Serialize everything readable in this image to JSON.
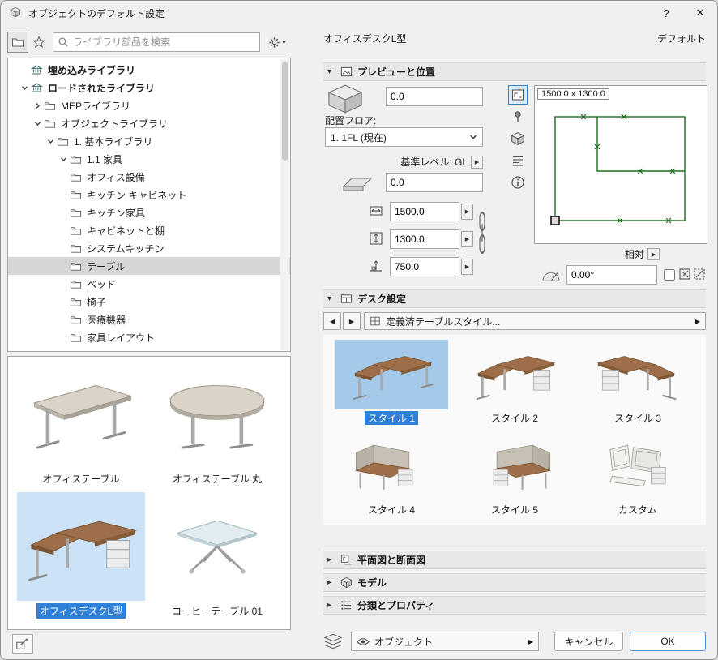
{
  "window": {
    "title": "オブジェクトのデフォルト設定",
    "help": "?",
    "close": "✕"
  },
  "glyphs": {
    "expand": "▾",
    "collapse": "▸",
    "prev": "◀",
    "next": "▶",
    "spinner": "▶",
    "dropdown": "▾"
  },
  "search": {
    "placeholder": "ライブラリ部品を検索"
  },
  "tree": [
    {
      "label": "埋め込みライブラリ"
    },
    {
      "label": "ロードされたライブラリ"
    },
    {
      "label": "MEPライブラリ"
    },
    {
      "label": "オブジェクトライブラリ"
    },
    {
      "label": "1. 基本ライブラリ"
    },
    {
      "label": "1.1 家具"
    },
    {
      "label": "オフィス設備"
    },
    {
      "label": "キッチン キャビネット"
    },
    {
      "label": "キッチン家具"
    },
    {
      "label": "キャビネットと棚"
    },
    {
      "label": "システムキッチン"
    },
    {
      "label": "テーブル"
    },
    {
      "label": "ベッド"
    },
    {
      "label": "椅子"
    },
    {
      "label": "医療機器"
    },
    {
      "label": "家具レイアウト"
    }
  ],
  "thumbs": [
    {
      "label": "オフィステーブル",
      "selected": false
    },
    {
      "label": "オフィステーブル 丸",
      "selected": false
    },
    {
      "label": "オフィスデスクL型",
      "selected": true
    },
    {
      "label": "コーヒーテーブル 01",
      "selected": false
    }
  ],
  "obj": {
    "name": "オフィスデスクL型",
    "state": "デフォルト"
  },
  "prev": {
    "title": "プレビューと位置",
    "z1": "0.0",
    "floor_label": "配置フロア:",
    "floor_value": "1. 1FL (現在)",
    "base_level": "基準レベル: GL",
    "z2": "0.0",
    "w": "1500.0",
    "d": "1300.0",
    "h": "750.0",
    "dims": "1500.0 x 1300.0",
    "relative": "相対",
    "angle": "0.00°"
  },
  "desk": {
    "title": "デスク設定",
    "header": "定義済テーブルスタイル...",
    "styles": [
      {
        "label": "スタイル 1",
        "selected": true
      },
      {
        "label": "スタイル 2",
        "selected": false
      },
      {
        "label": "スタイル 3",
        "selected": false
      },
      {
        "label": "スタイル 4",
        "selected": false
      },
      {
        "label": "スタイル 5",
        "selected": false
      },
      {
        "label": "カスタム",
        "selected": false
      }
    ]
  },
  "secs": [
    {
      "title": "平面図と断面図"
    },
    {
      "title": "モデル"
    },
    {
      "title": "分類とプロパティ"
    }
  ],
  "footer": {
    "layer": "オブジェクト",
    "cancel": "キャンセル",
    "ok": "OK"
  },
  "colors": {
    "accent": "#2f80d8",
    "selection_bg": "#cce3f7",
    "plan_line": "#1e6b1e"
  }
}
